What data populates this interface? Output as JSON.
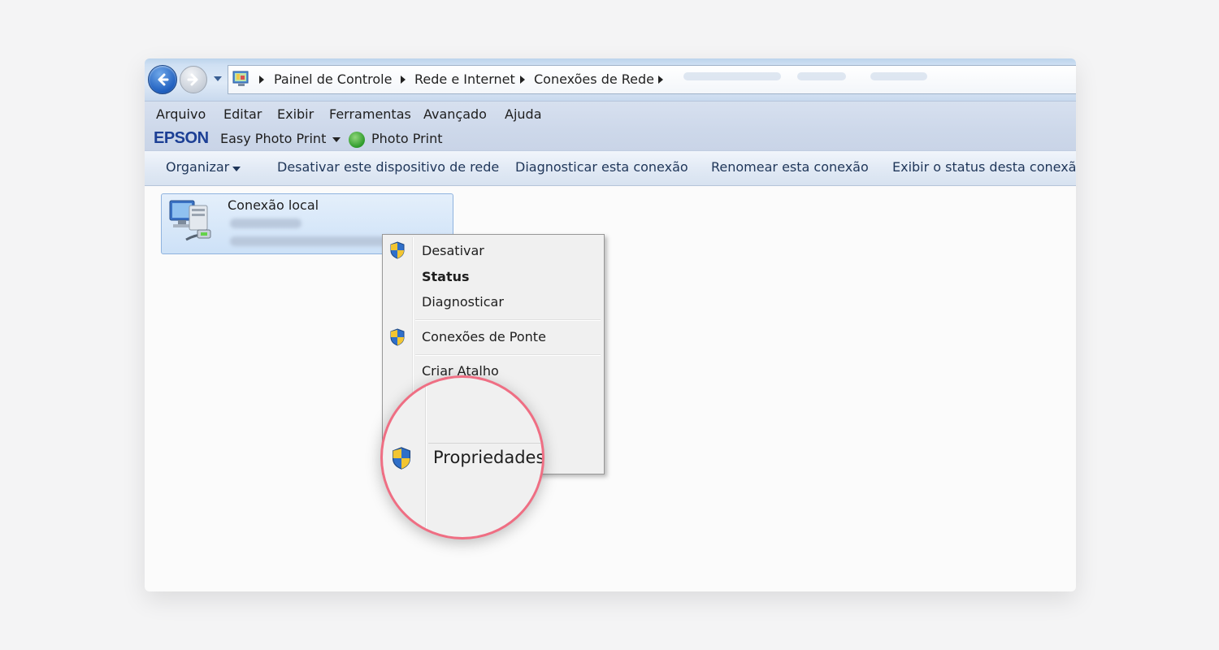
{
  "address_bar": {
    "breadcrumbs": [
      "Painel de Controle",
      "Rede e Internet",
      "Conexões de Rede"
    ]
  },
  "menu_bar": {
    "items": [
      "Arquivo",
      "Editar",
      "Exibir",
      "Ferramentas",
      "Avançado",
      "Ajuda"
    ]
  },
  "epson_toolbar": {
    "logo": "EPSON",
    "easy_photo_print": "Easy Photo Print",
    "photo_print": "Photo Print"
  },
  "command_bar": {
    "organize": "Organizar",
    "disable": "Desativar este dispositivo de rede",
    "diagnose": "Diagnosticar esta conexão",
    "rename": "Renomear esta conexão",
    "status": "Exibir o status desta conexão"
  },
  "connection": {
    "title": "Conexão local"
  },
  "context_menu": {
    "items": [
      "Desativar",
      "Status",
      "Diagnosticar",
      "Conexões de Ponte",
      "Criar Atalho",
      "Propriedades"
    ]
  },
  "magnifier": {
    "label": "Propriedades"
  },
  "colors": {
    "highlight_ring": "#ef6e83",
    "epson_blue": "#1c3f95",
    "tile_border": "#8fb3df"
  },
  "icons": [
    "back-arrow-icon",
    "forward-arrow-icon",
    "control-panel-icon",
    "network-computer-icon",
    "uac-shield-icon",
    "photo-print-icon"
  ]
}
